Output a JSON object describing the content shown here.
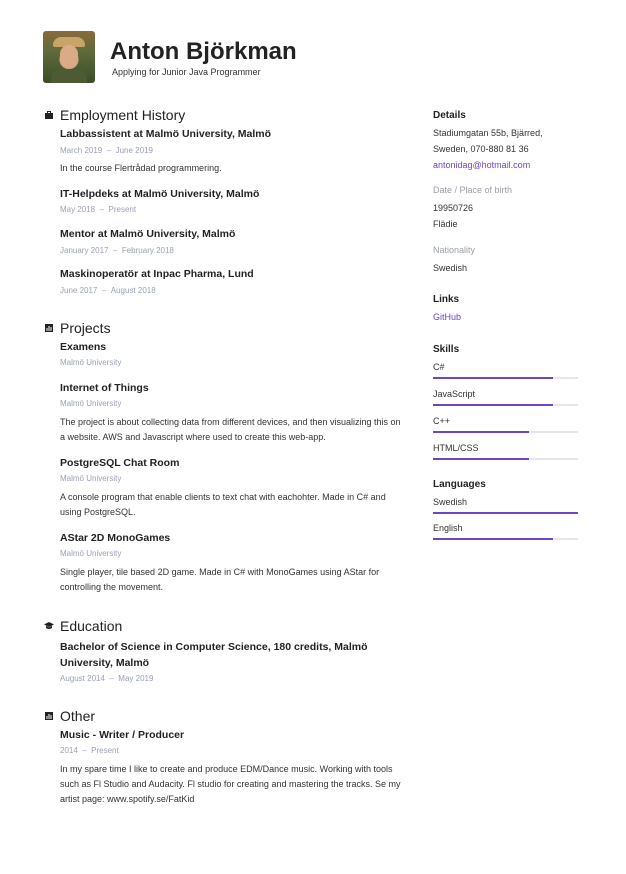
{
  "header": {
    "name": "Anton Björkman",
    "subtitle": "Applying for Junior Java Programmer"
  },
  "employment": {
    "title": "Employment History",
    "items": [
      {
        "title": "Labbassistent at Malmö University, Malmö",
        "date_from": "March 2019",
        "date_to": "June 2019",
        "description": "In the course Flertrådad programmering."
      },
      {
        "title": "IT-Helpdeks at Malmö University, Malmö",
        "date_from": "May 2018",
        "date_to": "Present"
      },
      {
        "title": "Mentor at Malmö University, Malmö",
        "date_from": "January 2017",
        "date_to": "February 2018"
      },
      {
        "title": "Maskinoperatör at Inpac Pharma, Lund",
        "date_from": "June 2017",
        "date_to": "August 2018"
      }
    ]
  },
  "projects": {
    "title": "Projects",
    "items": [
      {
        "title": "Examens",
        "org": "Malmö University"
      },
      {
        "title": "Internet of Things",
        "org": "Malmö University",
        "description": "The project is about collecting data from different devices, and then visualizing this on a website. AWS and Javascript where used to create this web-app."
      },
      {
        "title": "PostgreSQL Chat Room",
        "org": "Malmö University",
        "description": "A console program that enable clients to text chat with eachohter. Made in C# and using PostgreSQL."
      },
      {
        "title": "AStar 2D MonoGames",
        "org": "Malmö University",
        "description": "Single player, tile based 2D game. Made in C# with MonoGames using AStar for controlling the movement."
      }
    ]
  },
  "education": {
    "title": "Education",
    "item": {
      "title": "Bachelor of Science in Computer Science, 180 credits, Malmö University, Malmö",
      "date_from": "August 2014",
      "date_to": "May 2019"
    }
  },
  "other": {
    "title": "Other",
    "item": {
      "title": "Music - Writer / Producer",
      "date_from": "2014",
      "date_to": "Present",
      "description": "In my spare time I like to create and produce EDM/Dance music. Working with tools such as Fl Studio and Audacity. Fl studio for creating and mastering the tracks. Se my artist page: www.spotify.se/FatKid"
    }
  },
  "date_sep": "–",
  "sidebar": {
    "details_title": "Details",
    "address_line1": "Stadiumgatan 55b, Bjärred,",
    "address_line2": "Sweden, 070-880 81 36",
    "email": "antonidag@hotmail.com",
    "birth_label": "Date / Place of birth",
    "birth_date": "19950726",
    "birth_place": "Flädie",
    "nationality_label": "Nationality",
    "nationality": "Swedish",
    "links_title": "Links",
    "github": "GitHub",
    "skills_title": "Skills",
    "skills": [
      {
        "name": "C#",
        "level": 0.83
      },
      {
        "name": "JavaScript",
        "level": 0.83
      },
      {
        "name": "C++",
        "level": 0.66
      },
      {
        "name": "HTML/CSS",
        "level": 0.66
      }
    ],
    "languages_title": "Languages",
    "languages": [
      {
        "name": "Swedish",
        "level": 1.0
      },
      {
        "name": "English",
        "level": 0.83
      }
    ],
    "accent_color": "#6d45c7"
  }
}
